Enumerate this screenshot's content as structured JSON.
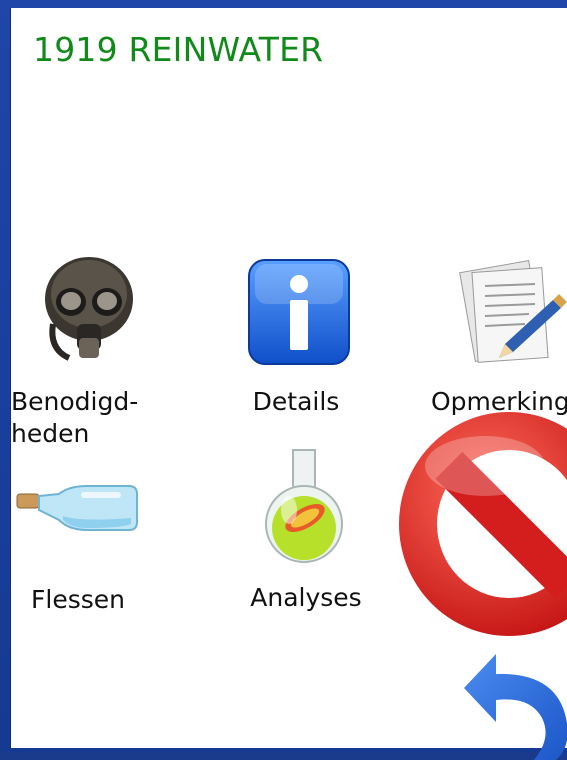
{
  "header": {
    "title": "1919 REINWATER"
  },
  "tiles": [
    {
      "label": "Benodigd-\nheden",
      "icon": "gas-mask-icon"
    },
    {
      "label": "Details",
      "icon": "info-icon"
    },
    {
      "label": "Opmerking",
      "icon": "notes-pen-icon"
    },
    {
      "label": "Flessen",
      "icon": "bottle-icon"
    },
    {
      "label": "Analyses",
      "icon": "flask-icon"
    }
  ],
  "overlay": {
    "icon": "no-entry-icon"
  },
  "nav": {
    "back_icon": "undo-arrow-icon"
  },
  "colors": {
    "title": "#128a1a",
    "frame": "#1f46a8",
    "no_sign": "#d41e1e"
  }
}
